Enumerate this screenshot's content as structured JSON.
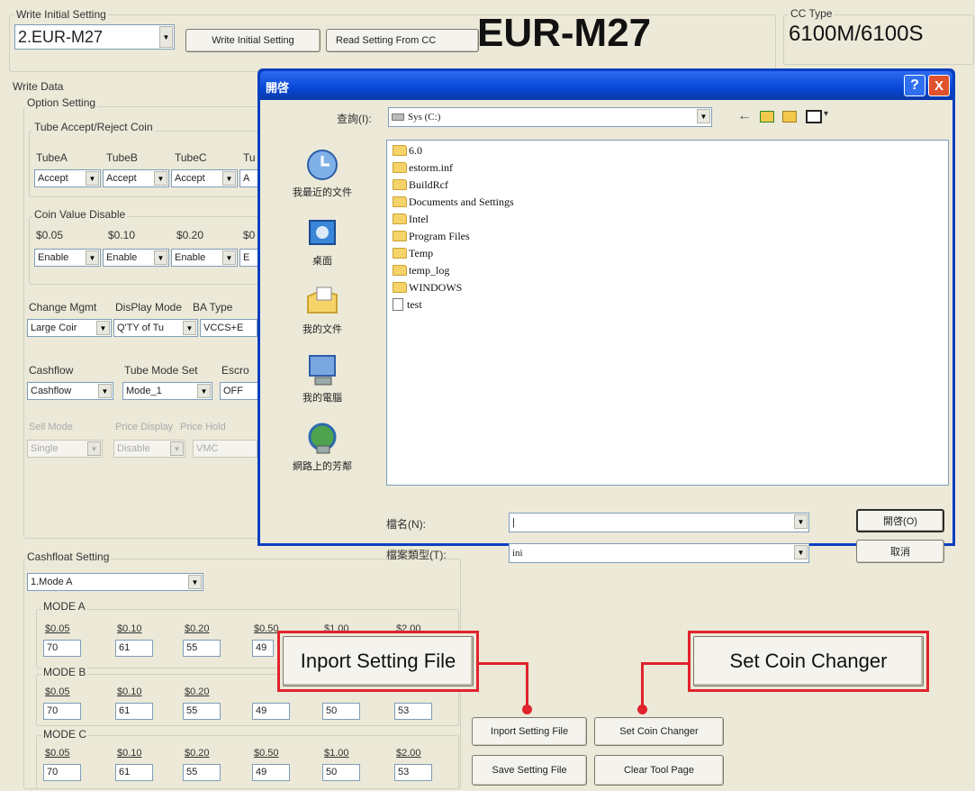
{
  "header": {
    "write_initial_group": "Write Initial Setting",
    "model_select": "2.EUR-M27",
    "write_initial_button": "Write Initial Setting",
    "read_setting_button": "Read Setting From CC",
    "big_model": "EUR-M27",
    "cc_type_label": "CC Type",
    "cc_type_value": "6100M/6100S"
  },
  "write_data": {
    "label": "Write Data",
    "option_setting": "Option Setting",
    "tube_group": "Tube Accept/Reject Coin",
    "tubes": [
      "TubeA",
      "TubeB",
      "TubeC",
      "Tu"
    ],
    "tube_values": [
      "Accept",
      "Accept",
      "Accept",
      "A"
    ],
    "coin_disable_group": "Coin Value Disable",
    "coins": [
      "$0.05",
      "$0.10",
      "$0.20",
      "$0"
    ],
    "coin_values": [
      "Enable",
      "Enable",
      "Enable",
      "E"
    ],
    "change_mgmt_label": "Change Mgmt",
    "display_mode_label": "DisPlay Mode",
    "ba_type_label": "BA Type",
    "change_mgmt_value": "Large Coir",
    "display_mode_value": "Q'TY of Tu",
    "ba_type_value": "VCCS+E",
    "cashflow_label": "Cashflow",
    "tube_mode_label": "Tube Mode Set",
    "escrow_label": "Escro",
    "cashflow_value": "Cashflow",
    "tube_mode_value": "Mode_1",
    "escrow_value": "OFF",
    "sell_mode_label": "Sell Mode",
    "price_display_label": "Price Display",
    "price_hold_label": "Price Hold",
    "sell_mode_value": "Single",
    "price_display_value": "Disable",
    "price_hold_value": "VMC"
  },
  "cashfloat": {
    "label": "Cashfloat Setting",
    "mode_select": "1.Mode A",
    "coin_labels": [
      "$0.05",
      "$0.10",
      "$0.20",
      "$0.50",
      "$1.00",
      "$2.00"
    ],
    "modes": [
      {
        "name": "MODE A",
        "values": [
          "70",
          "61",
          "55",
          "49",
          "",
          ""
        ]
      },
      {
        "name": "MODE B",
        "values": [
          "70",
          "61",
          "55",
          "49",
          "50",
          "53"
        ]
      },
      {
        "name": "MODE C",
        "values": [
          "70",
          "61",
          "55",
          "49",
          "50",
          "53"
        ]
      }
    ]
  },
  "buttons": {
    "inport": "Inport Setting File",
    "set_coin": "Set  Coin Changer",
    "save": "Save Setting File",
    "clear": "Clear Tool Page"
  },
  "callouts": {
    "inport": "Inport Setting File",
    "set_coin": "Set  Coin Changer"
  },
  "dialog": {
    "title": "開啓",
    "lookin_label": "查詢(I):",
    "lookin_value": "Sys (C:)",
    "places": [
      "我最近的文件",
      "桌面",
      "我的文件",
      "我的電腦",
      "網路上的芳鄰"
    ],
    "files": [
      {
        "name": "6.0",
        "type": "folder"
      },
      {
        "name": "estorm.inf",
        "type": "folder"
      },
      {
        "name": "BuildRcf",
        "type": "folder"
      },
      {
        "name": "Documents and Settings",
        "type": "folder"
      },
      {
        "name": "Intel",
        "type": "folder"
      },
      {
        "name": "Program Files",
        "type": "folder"
      },
      {
        "name": "Temp",
        "type": "folder"
      },
      {
        "name": "temp_log",
        "type": "folder"
      },
      {
        "name": "WINDOWS",
        "type": "folder"
      },
      {
        "name": "test",
        "type": "file"
      }
    ],
    "filename_label": "檔名(N):",
    "filename_value": "|",
    "filetype_label": "檔案類型(T):",
    "filetype_value": "ini",
    "open_button": "開啓(O)",
    "cancel_button": "取消",
    "help_button": "?",
    "close_button": "X"
  },
  "colors": {
    "accent_red": "#e0232d",
    "dialog_blue": "#0a3fc0",
    "window_bg": "#ece9d8"
  }
}
